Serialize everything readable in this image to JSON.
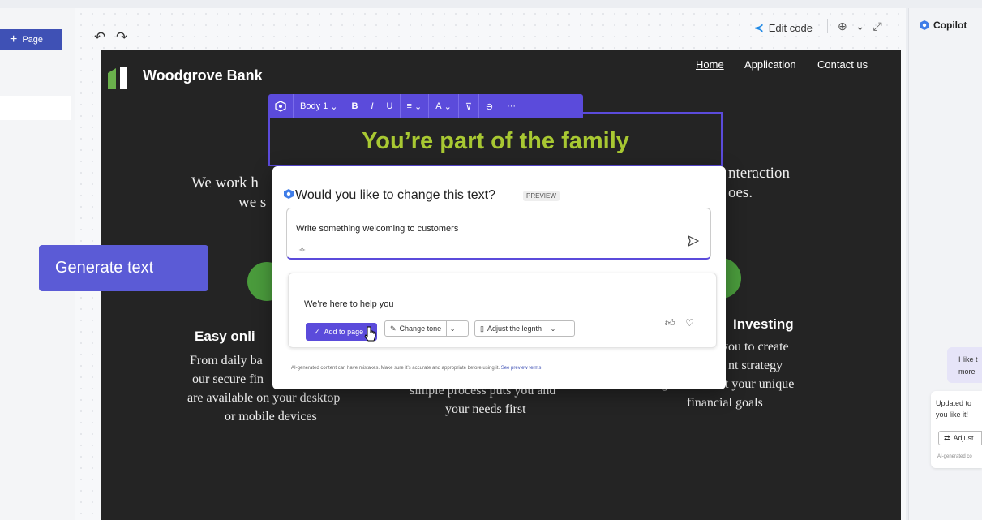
{
  "left_panel": {
    "add_page_label": "Page",
    "add_page_icon": "plus-icon"
  },
  "canvas_toolbar": {
    "undo_icon": "undo-icon",
    "redo_icon": "redo-icon",
    "edit_code_label": "Edit code",
    "zoom_icon": "zoom-icon",
    "expand_icon": "expand-icon"
  },
  "site": {
    "brand": "Woodgrove Bank",
    "nav": [
      "Home",
      "Application",
      "Contact us"
    ],
    "heading": "You’re part of the family",
    "intro_left_1": "We work h",
    "intro_left_2": "we s",
    "intro_right_1": "nteraction",
    "intro_right_2": "oes.",
    "col1_title": "Easy onli",
    "col1_lines": [
      "From daily ba",
      "our secure fin",
      "are available on your desktop",
      "or mobile devices"
    ],
    "col2_lines": [
      "simple process puts you and",
      "your needs first"
    ],
    "col3_title": "Investing",
    "col3_lines": [
      "n you to create",
      "nt strategy",
      "designed to meet your unique",
      "financial goals"
    ]
  },
  "text_toolbar": {
    "style": "Body 1",
    "bold": "B",
    "italic": "I",
    "underline": "U",
    "more": "···"
  },
  "ai_popup": {
    "title": "Would you like to change this text?",
    "badge": "PREVIEW",
    "prompt": "Write something welcoming to customers",
    "result": "We’re here to help you",
    "add_label": "Add to page",
    "change_tone_label": "Change tone",
    "adjust_length_label": "Adjust the legnth",
    "disclaimer": "AI-generated content can have mistakes. Make sure it’s accurate and appropriate before using it.",
    "disclaimer_link": "See preview terms"
  },
  "callout": {
    "label": "Generate text"
  },
  "copilot": {
    "title": "Copilot",
    "user_msg_1": "I like t",
    "user_msg_2": "more",
    "bot_msg_1": "Updated to",
    "bot_msg_2": "you like it!",
    "adjust_label": "Adjust",
    "disclaimer": "AI-generated co"
  },
  "colors": {
    "accent": "#5b4bdb",
    "heading_green": "#a8c832",
    "site_bg": "#242424",
    "icon_green": "#4a9b3c"
  }
}
